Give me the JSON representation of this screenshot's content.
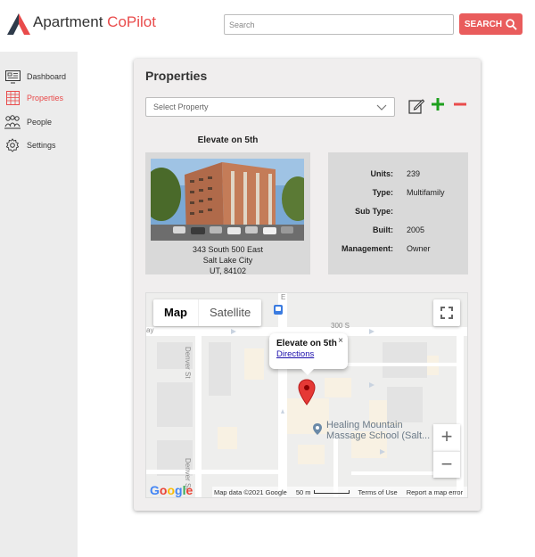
{
  "app": {
    "brand_part1": "Apartment",
    "brand_part2": "CoPilot",
    "accent_color": "#e94b4b"
  },
  "header": {
    "search_placeholder": "Search",
    "search_button": "SEARCH"
  },
  "sidebar": {
    "items": [
      {
        "label": "Dashboard",
        "icon": "dashboard-icon",
        "active": false
      },
      {
        "label": "Properties",
        "icon": "building-icon",
        "active": true
      },
      {
        "label": "People",
        "icon": "people-icon",
        "active": false
      },
      {
        "label": "Settings",
        "icon": "gear-icon",
        "active": false
      }
    ]
  },
  "properties": {
    "title": "Properties",
    "select_placeholder": "Select Property",
    "property_name": "Elevate on 5th",
    "address": {
      "line1": "343 South  500 East",
      "line2": "Salt Lake City",
      "line3": "UT, 84102"
    },
    "details": [
      {
        "label": "Units:",
        "value": "239"
      },
      {
        "label": "Type:",
        "value": "Multifamily"
      },
      {
        "label": "Sub Type:",
        "value": ""
      },
      {
        "label": "Built:",
        "value": "2005"
      },
      {
        "label": "Management:",
        "value": "Owner"
      }
    ]
  },
  "map": {
    "type_map": "Map",
    "type_satellite": "Satellite",
    "info_title": "Elevate on 5th",
    "info_link": "Directions",
    "info_close": "×",
    "street_300s": "300 S",
    "street_denver_1": "Denver St",
    "street_denver_2": "Denver St",
    "street_ay": "ay",
    "street_e": "E",
    "poi_line1": "Healing Mountain",
    "poi_line2": "Massage School (Salt...",
    "zoom_in": "+",
    "zoom_out": "−",
    "footer_data": "Map data ©2021 Google",
    "footer_scale": "50 m",
    "footer_terms": "Terms of Use",
    "footer_report": "Report a map error",
    "google_logo": "Google"
  }
}
